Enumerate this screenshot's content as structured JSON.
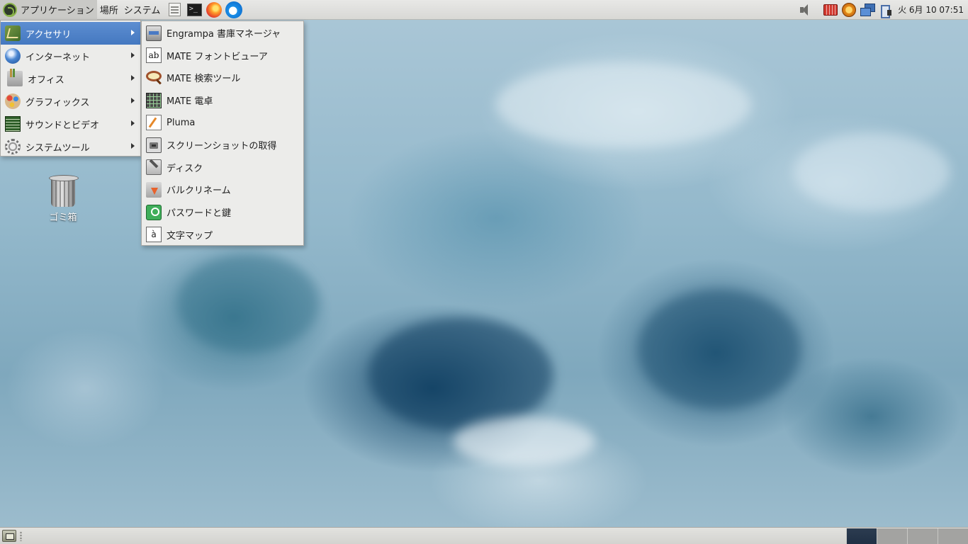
{
  "top_panel": {
    "menus": [
      {
        "label": "アプリケーション",
        "icon": "mate-logo-icon"
      },
      {
        "label": "場所"
      },
      {
        "label": "システム"
      }
    ],
    "launchers": [
      {
        "name": "file-manager",
        "icon": "file-manager-icon"
      },
      {
        "name": "terminal",
        "icon": "terminal-icon",
        "glyph": ">_"
      },
      {
        "name": "firefox",
        "icon": "firefox-icon"
      },
      {
        "name": "thunderbird",
        "icon": "thunderbird-icon"
      }
    ],
    "tray": [
      "volume-icon",
      "keyboard-icon",
      "update-notifier-icon",
      "network-icon",
      "power-icon"
    ],
    "clock": "火 6月 10 07:51"
  },
  "applications_menu": {
    "items": [
      {
        "label": "アクセサリ",
        "icon": "accessories-icon",
        "selected": true
      },
      {
        "label": "インターネット",
        "icon": "internet-icon"
      },
      {
        "label": "オフィス",
        "icon": "office-icon"
      },
      {
        "label": "グラフィックス",
        "icon": "graphics-icon"
      },
      {
        "label": "サウンドとビデオ",
        "icon": "sound-video-icon"
      },
      {
        "label": "システムツール",
        "icon": "system-tools-icon"
      }
    ]
  },
  "accessories_submenu": {
    "items": [
      {
        "label": "Engrampa 書庫マネージャ",
        "icon": "archive-manager-icon"
      },
      {
        "label": "MATE フォントビューア",
        "icon": "font-viewer-icon",
        "glyph": "ab"
      },
      {
        "label": "MATE 検索ツール",
        "icon": "search-tool-icon"
      },
      {
        "label": "MATE 電卓",
        "icon": "calculator-icon"
      },
      {
        "label": "Pluma",
        "icon": "text-editor-icon"
      },
      {
        "label": "スクリーンショットの取得",
        "icon": "screenshot-icon"
      },
      {
        "label": "ディスク",
        "icon": "disks-icon"
      },
      {
        "label": "バルクリネーム",
        "icon": "bulk-rename-icon"
      },
      {
        "label": "パスワードと鍵",
        "icon": "passwords-keys-icon"
      },
      {
        "label": "文字マップ",
        "icon": "character-map-icon",
        "glyph": "à"
      }
    ]
  },
  "desktop": {
    "icons": [
      {
        "label": "ゴミ箱",
        "icon": "trash-icon"
      }
    ]
  },
  "bottom_panel": {
    "workspaces": 4,
    "current_workspace": 1
  },
  "colors": {
    "panel": "#dcdcd9",
    "menu_bg": "#ececea",
    "selection": "#4f82c7",
    "workspace_active": "#26374b"
  }
}
